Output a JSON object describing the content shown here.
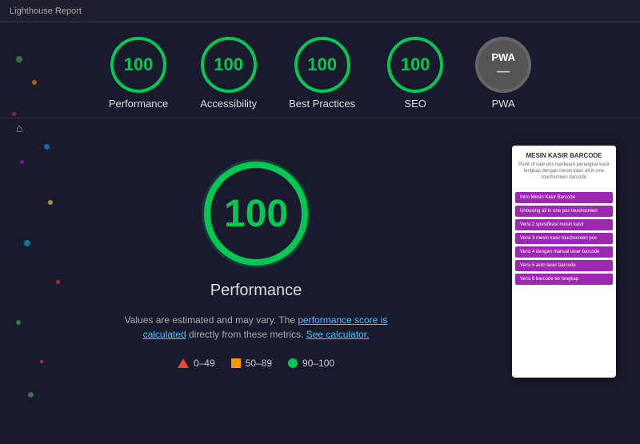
{
  "topbar": {
    "title": "Lighthouse Report"
  },
  "scores": [
    {
      "id": "performance",
      "value": "100",
      "label": "Performance",
      "type": "score"
    },
    {
      "id": "accessibility",
      "value": "100",
      "label": "Accessibility",
      "type": "score"
    },
    {
      "id": "best-practices",
      "value": "100",
      "label": "Best Practices",
      "type": "score"
    },
    {
      "id": "seo",
      "value": "100",
      "label": "SEO",
      "type": "score"
    },
    {
      "id": "pwa",
      "value": "PWA",
      "label": "PWA",
      "type": "pwa"
    }
  ],
  "main": {
    "big_score": "100",
    "big_label": "Performance",
    "description_pre": "Values are estimated and may vary. The ",
    "description_link1": "performance score is calculated",
    "description_mid": " directly from these metrics. ",
    "description_link2": "See calculator.",
    "legend": [
      {
        "color": "red",
        "range": "0–49"
      },
      {
        "color": "orange",
        "range": "50–89"
      },
      {
        "color": "green",
        "range": "90–100"
      }
    ]
  },
  "phone": {
    "title": "MESIN KASIR BARCODE",
    "subtitle": "Point of sale pos hardware perangkat kasir lengkap dengan mesin kasir all in one touchscreen barcode",
    "menu_items": [
      "Intro Mesin Kasir Barcode",
      "Unboxing all in one pos touchscreen",
      "Versi 2 spesifikasi mesin kasir",
      "Versi 3 mesin kasir touchscreen pos",
      "Versi 4 dengan manual laser barcode",
      "Versi 5 auto laser barcode",
      "Versi 6 barcode ter lengkap"
    ]
  },
  "colors": {
    "green": "#00c853",
    "accent": "#4fc3f7",
    "red": "#f44336",
    "orange": "#ff9800",
    "purple": "#9c27b0"
  }
}
